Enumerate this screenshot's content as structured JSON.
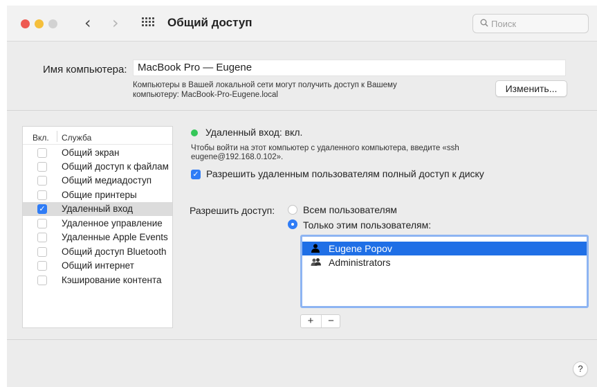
{
  "titlebar": {
    "title": "Общий доступ",
    "back_glyph": "‹",
    "forward_glyph": "›",
    "search_placeholder": "Поиск",
    "search_icon": "magnifier-icon"
  },
  "computer": {
    "name_label": "Имя компьютера:",
    "name_value": "MacBook Pro — Eugene",
    "note_line1": "Компьютеры в Вашей локальной сети могут получить доступ к Вашему",
    "note_line2": "компьютеру: MacBook-Pro-Eugene.local",
    "change_button": "Изменить..."
  },
  "services": {
    "header_on": "Вкл.",
    "header_service": "Служба",
    "items": [
      {
        "label": "Общий экран",
        "checked": false
      },
      {
        "label": "Общий доступ к файлам",
        "checked": false
      },
      {
        "label": "Общий медиадоступ",
        "checked": false
      },
      {
        "label": "Общие принтеры",
        "checked": false
      },
      {
        "label": "Удаленный вход",
        "checked": true,
        "selected": true
      },
      {
        "label": "Удаленное управление",
        "checked": false
      },
      {
        "label": "Удаленные Apple Events",
        "checked": false
      },
      {
        "label": "Общий доступ Bluetooth",
        "checked": false
      },
      {
        "label": "Общий интернет",
        "checked": false
      },
      {
        "label": "Кэширование контента",
        "checked": false
      }
    ]
  },
  "detail": {
    "status": "Удаленный вход: вкл.",
    "status_color": "#35c759",
    "hint_line1": "Чтобы войти на этот компьютер с удаленного компьютера, введите «ssh",
    "hint_line2": "eugene@192.168.0.102».",
    "full_disk_label": "Разрешить удаленным пользователям полный доступ к диску",
    "full_disk_checked": true,
    "access_label": "Разрешить доступ:",
    "radio_all": "Всем пользователям",
    "radio_only": "Только этим пользователям:",
    "selected_radio": "only",
    "users": [
      {
        "name": "Eugene Popov",
        "icon": "person-icon",
        "selected": true
      },
      {
        "name": "Administrators",
        "icon": "group-icon",
        "selected": false
      }
    ],
    "add_button": "+",
    "remove_button": "−"
  },
  "help_button": "?",
  "colors": {
    "accent": "#2f7cf6",
    "selection": "#1f6fe6"
  }
}
